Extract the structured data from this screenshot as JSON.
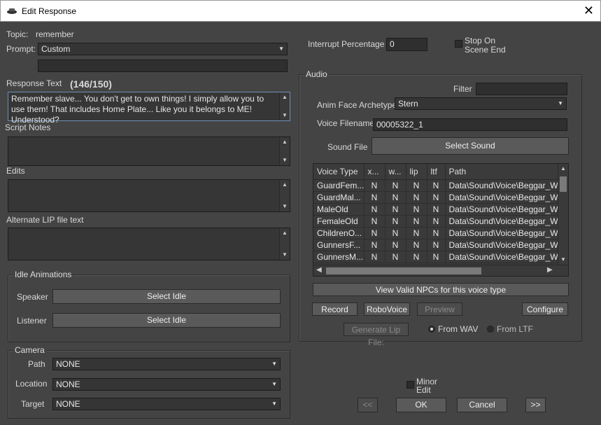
{
  "window": {
    "title": "Edit Response",
    "close_glyph": "✕"
  },
  "left": {
    "topic_label": "Topic:",
    "topic_value": "remember",
    "prompt_label": "Prompt:",
    "prompt_value": "Custom",
    "prompt_text": "",
    "response_label": "Response Text",
    "response_count": "(146/150)",
    "response_text": "Remember slave... You don't get to own things! I simply allow you to use them! That includes Home Plate... Like you it belongs to ME! Understood?",
    "script_notes_label": "Script Notes",
    "script_notes": "",
    "edits_label": "Edits",
    "edits": "",
    "lip_label": "Alternate LIP file text",
    "lip_text": "",
    "idle": {
      "caption": "Idle Animations",
      "speaker_label": "Speaker",
      "speaker_button": "Select Idle",
      "listener_label": "Listener",
      "listener_button": "Select Idle"
    },
    "camera": {
      "caption": "Camera",
      "path_label": "Path",
      "path_value": "NONE",
      "location_label": "Location",
      "location_value": "NONE",
      "target_label": "Target",
      "target_value": "NONE"
    }
  },
  "right": {
    "interrupt_label": "Interrupt Percentage",
    "interrupt_value": "0",
    "stop_label_1": "Stop On",
    "stop_label_2": "Scene End",
    "audio": {
      "caption": "Audio",
      "filter_label": "Filter",
      "filter_value": "",
      "archetype_label": "Anim Face Archetype",
      "archetype_value": "Stern",
      "voice_label": "Voice Filename",
      "voice_value": "00005322_1",
      "sound_label": "Sound File",
      "sound_button": "Select Sound",
      "columns": [
        "Voice Type",
        "x...",
        "w...",
        "lip",
        "ltf",
        "Path"
      ],
      "rows": [
        [
          "GuardFem...",
          "N",
          "N",
          "N",
          "N",
          "Data\\Sound\\Voice\\Beggar_Who"
        ],
        [
          "GuardMal...",
          "N",
          "N",
          "N",
          "N",
          "Data\\Sound\\Voice\\Beggar_Who"
        ],
        [
          "MaleOld",
          "N",
          "N",
          "N",
          "N",
          "Data\\Sound\\Voice\\Beggar_Who"
        ],
        [
          "FemaleOld",
          "N",
          "N",
          "N",
          "N",
          "Data\\Sound\\Voice\\Beggar_Who"
        ],
        [
          "ChildrenO...",
          "N",
          "N",
          "N",
          "N",
          "Data\\Sound\\Voice\\Beggar_Who"
        ],
        [
          "GunnersF...",
          "N",
          "N",
          "N",
          "N",
          "Data\\Sound\\Voice\\Beggar_Who"
        ],
        [
          "GunnersM...",
          "N",
          "N",
          "N",
          "N",
          "Data\\Sound\\Voice\\Beggar_Who"
        ]
      ],
      "view_npcs_button": "View Valid NPCs for this voice type",
      "record_button": "Record",
      "robovoice_button": "RoboVoice",
      "preview_button": "Preview",
      "configure_button": "Configure",
      "generate_lip_button": "Generate Lip File:",
      "from_wav": "From WAV",
      "from_ltf": "From LTF"
    },
    "minor_edit_1": "Minor",
    "minor_edit_2": "Edit",
    "prev_button": "<<",
    "ok_button": "OK",
    "cancel_button": "Cancel",
    "next_button": ">>"
  }
}
